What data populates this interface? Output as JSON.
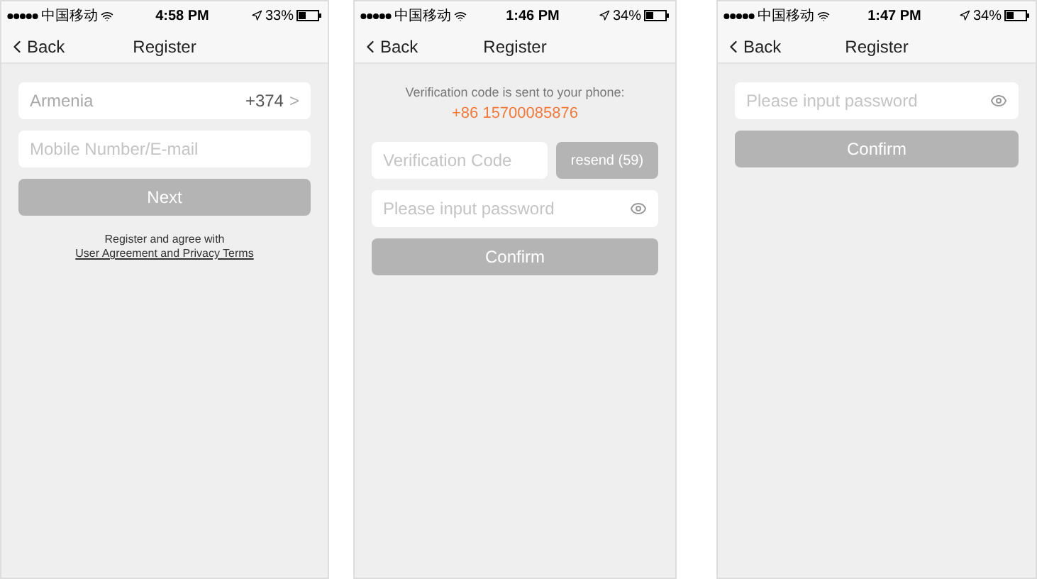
{
  "screens": [
    {
      "status_bar": {
        "carrier": "中国移动",
        "time": "4:58 PM",
        "battery": "33%"
      },
      "nav": {
        "back": "Back",
        "title": "Register"
      },
      "items": [
        {
          "kind": "picker",
          "label": "Armenia",
          "value": "+374",
          "chevron": ">"
        },
        {
          "kind": "input",
          "placeholder": "Mobile Number/E-mail"
        },
        {
          "kind": "button",
          "label": "Next",
          "disabled": true
        },
        {
          "kind": "note",
          "text": "Register and agree with",
          "link": "User Agreement and Privacy Terms"
        }
      ]
    },
    {
      "status_bar": {
        "carrier": "中国移动",
        "time": "1:46 PM",
        "battery": "34%"
      },
      "nav": {
        "back": "Back",
        "title": "Register"
      },
      "items": [
        {
          "kind": "info",
          "text": "Verification code is sent to your phone:",
          "phone": "+86 15700085876"
        },
        {
          "kind": "code_row",
          "placeholder": "Verification Code",
          "button": "resend (59)",
          "disabled": true
        },
        {
          "kind": "password",
          "placeholder": "Please input password"
        },
        {
          "kind": "button",
          "label": "Confirm",
          "disabled": true
        }
      ]
    },
    {
      "status_bar": {
        "carrier": "中国移动",
        "time": "1:47 PM",
        "battery": "34%"
      },
      "nav": {
        "back": "Back",
        "title": "Register"
      },
      "items": [
        {
          "kind": "password",
          "placeholder": "Please input password"
        },
        {
          "kind": "button",
          "label": "Confirm",
          "disabled": true
        }
      ]
    }
  ]
}
